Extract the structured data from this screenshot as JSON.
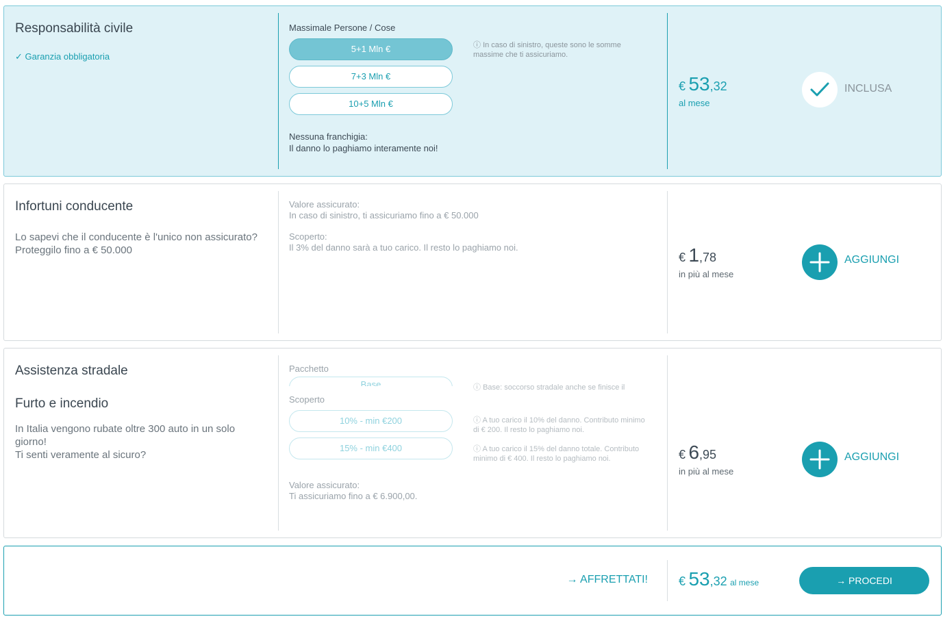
{
  "colors": {
    "accent": "#1a9fb0",
    "selected_bg": "#dff2f7"
  },
  "rc": {
    "title": "Responsabilità civile",
    "subtitle": "Garanzia obbligatoria",
    "massimale_label": "Massimale Persone / Cose",
    "options": [
      "5+1 Mln €",
      "7+3 Mln €",
      "10+5 Mln €"
    ],
    "selected_option": "5+1 Mln €",
    "note": "In caso di sinistro, queste sono le somme massime che ti assicuriamo.",
    "franchigia_label": "Nessuna franchigia:",
    "franchigia_text": "Il danno lo paghiamo interamente noi!",
    "price_currency": "€",
    "price_int": "53",
    "price_cents": ",32",
    "price_sub": "al mese",
    "action": "INCLUSA"
  },
  "infortuni": {
    "title": "Infortuni conducente",
    "desc": "Lo sapevi che il conducente è l'unico non assicurato?",
    "desc2": "Proteggilo fino a € 50.000",
    "valore_label": "Valore assicurato:",
    "valore_text": "In caso di sinistro, ti assicuriamo fino a € 50.000",
    "scoperto_label": "Scoperto:",
    "scoperto_text": "Il 3% del danno sarà a tuo carico. Il resto lo paghiamo noi.",
    "price_currency": "€",
    "price_int": "1",
    "price_cents": ",78",
    "price_sub": "in più al mese",
    "action": "AGGIUNGI"
  },
  "assistenza": {
    "title": "Assistenza stradale",
    "title2": "Furto e incendio",
    "desc": "In Italia vengono rubate oltre 300 auto in un solo giorno!",
    "desc2": "Ti senti veramente al sicuro?",
    "pacchetto_label": "Pacchetto",
    "pacchetto_option": "Base",
    "pacchetto_note": "Base: soccorso stradale anche se finisce il",
    "scoperto_label": "Scoperto",
    "scoperto_options": [
      "10% - min €200",
      "15% - min €400"
    ],
    "scoperto_notes": [
      "A tuo carico il 10% del danno. Contributo minimo di € 200. Il resto lo paghiamo noi.",
      "A tuo carico il 15% del danno totale. Contributo minimo di € 400. Il resto lo paghiamo noi."
    ],
    "valore_label": "Valore assicurato:",
    "valore_text": "Ti assicuriamo fino a € 6.900,00.",
    "price_currency": "€",
    "price_int": "6",
    "price_cents": ",95",
    "price_sub": "in più al mese",
    "action": "AGGIUNGI"
  },
  "footer": {
    "hurry": "AFFRETTATI!",
    "price_currency": "€",
    "price_int": "53",
    "price_cents": ",32",
    "price_sub": "al mese",
    "proceed": "PROCEDI"
  }
}
